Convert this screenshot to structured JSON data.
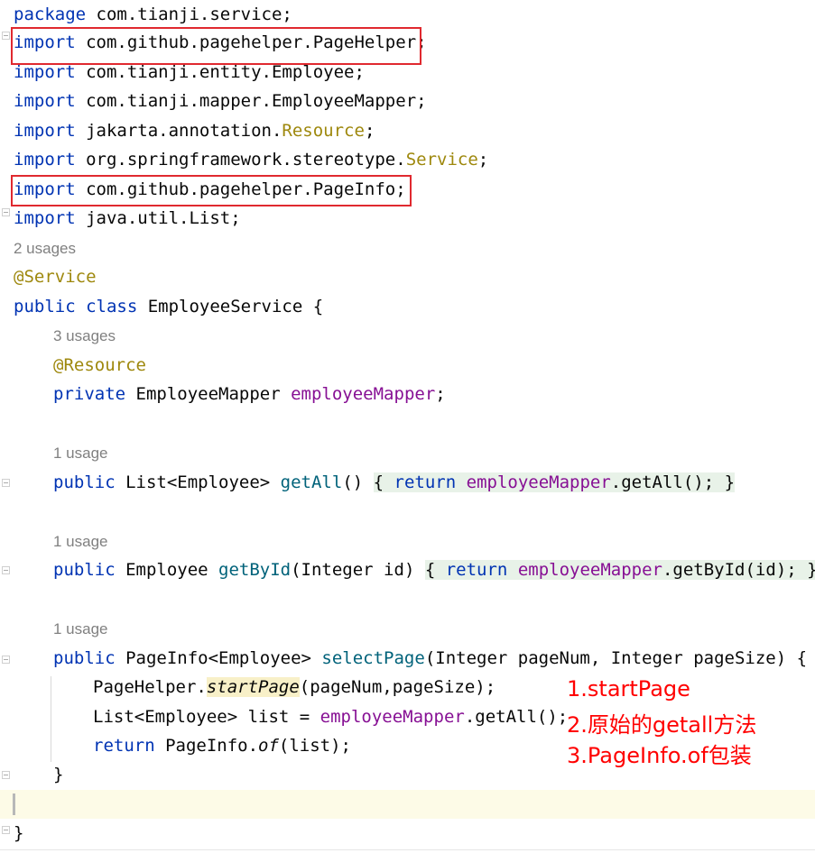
{
  "code": {
    "package_line": {
      "kw": "package",
      "rest": " com.tianji.service;"
    },
    "imports": [
      {
        "kw": "import",
        "path": " com.github.pagehelper.PageHelper",
        "hl": "",
        "end": ";"
      },
      {
        "kw": "import",
        "path": " com.tianji.entity.Employee",
        "hl": "",
        "end": ";"
      },
      {
        "kw": "import",
        "path": " com.tianji.mapper.EmployeeMapper",
        "hl": "",
        "end": ";"
      },
      {
        "kw": "import",
        "path": " jakarta.annotation.",
        "hl": "Resource",
        "end": ";"
      },
      {
        "kw": "import",
        "path": " org.springframework.stereotype.",
        "hl": "Service",
        "end": ";"
      },
      {
        "kw": "import",
        "path": " com.github.pagehelper.PageInfo",
        "hl": "",
        "end": ";"
      },
      {
        "kw": "import",
        "path": " java.util.List",
        "hl": "",
        "end": ";"
      }
    ],
    "usages_class": "2 usages",
    "annotation_service": "@Service",
    "class_decl": {
      "kw1": "public",
      "kw2": " class",
      "name": " EmployeeService {"
    },
    "usages_field": "3 usages",
    "annotation_resource": "@Resource",
    "field_decl": {
      "kw": "private",
      "type": " EmployeeMapper ",
      "name": "employeeMapper",
      "end": ";"
    },
    "usages_getall": "1 usage",
    "getall": {
      "kw": "public",
      "type": " List<Employee> ",
      "name": "getAll",
      "parens": "()",
      "brace_open": "{ ",
      "ret": "return",
      "field": "employeeMapper",
      "call": ".getAll();",
      "brace_close": "}"
    },
    "usages_getbyid": "1 usage",
    "getbyid": {
      "kw": "public",
      "type": " Employee ",
      "name": "getById",
      "params": "(Integer id)",
      "brace_open": "{ ",
      "ret": "return",
      "field": "employeeMapper",
      "call": ".getById(id);",
      "brace_close": "}"
    },
    "usages_selectpage": "1 usage",
    "selectpage": {
      "kw": "public",
      "type": " PageInfo<Employee> ",
      "name": "selectPage",
      "params": "(Integer pageNum, Integer pageSize) {",
      "line1_a": "PageHelper.",
      "line1_b": "startPage",
      "line1_c": "(pageNum,pageSize);",
      "line2_a": "List<Employee> list = ",
      "line2_b": "employeeMapper",
      "line2_c": ".getAll();",
      "line3_kw": "return",
      "line3_a": " PageInfo.",
      "line3_b": "of",
      "line3_c": "(list);",
      "close": "}"
    },
    "class_close": "}"
  },
  "notes": {
    "step1": "1.startPage",
    "step2": "2.原始的getall方法",
    "step3": "3.PageInfo.of包装"
  }
}
